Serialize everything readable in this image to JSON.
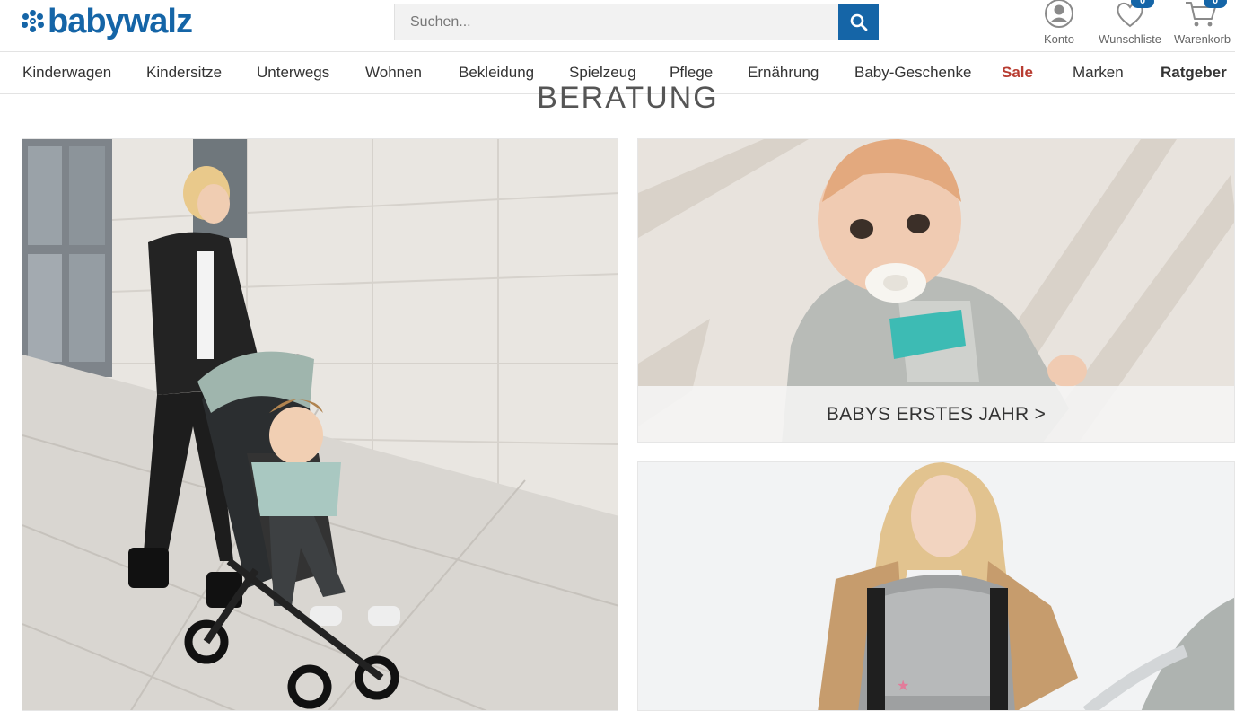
{
  "brand": {
    "name": "babywalz",
    "color": "#1565a7"
  },
  "search": {
    "placeholder": "Suchen...",
    "value": ""
  },
  "header_icons": [
    {
      "label": "Konto",
      "icon": "user-icon"
    },
    {
      "label": "Wunschliste",
      "icon": "heart-icon",
      "badge": "0"
    },
    {
      "label": "Warenkorb",
      "icon": "cart-icon",
      "badge": "0"
    }
  ],
  "nav": {
    "items": [
      "Kinderwagen",
      "Kindersitze",
      "Unterwegs",
      "Wohnen",
      "Bekleidung",
      "Spielzeug",
      "Pflege",
      "Ernährung",
      "Baby-Geschenke",
      "Sale",
      "Marken",
      "Ratgeber"
    ],
    "sale_color": "#b83c31"
  },
  "section": {
    "title": "BERATUNG"
  },
  "tiles": {
    "stroller": {
      "alt": ""
    },
    "baby": {
      "caption": "BABYS ERSTES JAHR >"
    },
    "carrier": {
      "alt": ""
    }
  }
}
